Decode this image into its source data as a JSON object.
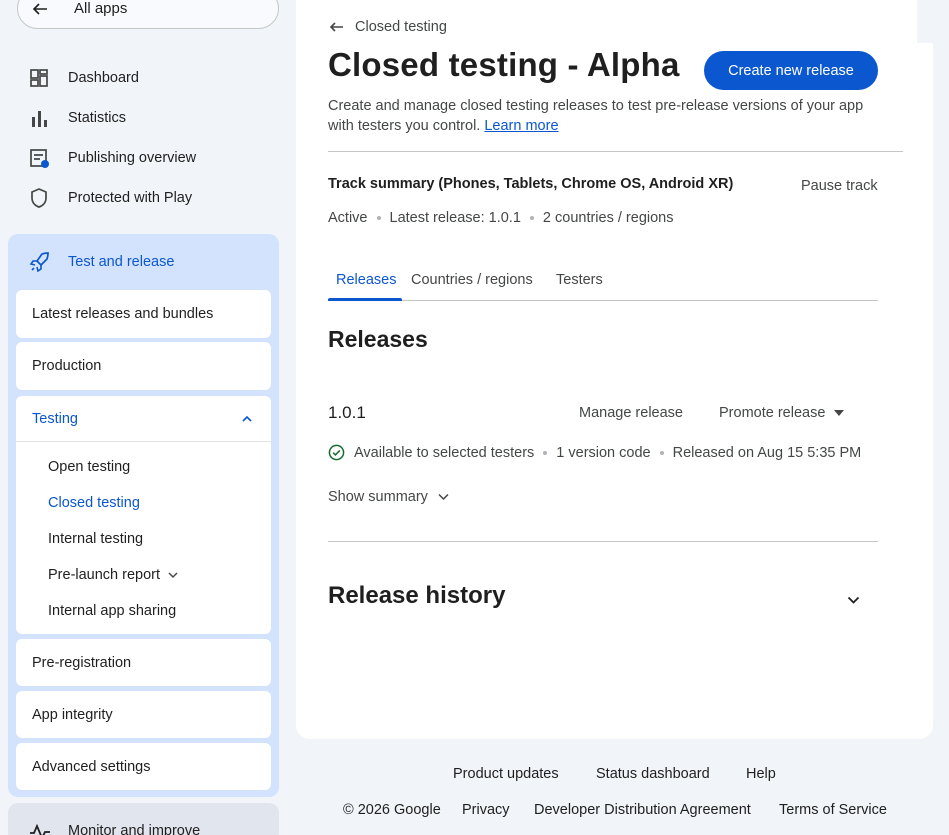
{
  "sidebar": {
    "all_apps": "All apps",
    "nav": [
      {
        "label": "Dashboard",
        "icon": "dashboard-icon"
      },
      {
        "label": "Statistics",
        "icon": "bar-chart-icon"
      },
      {
        "label": "Publishing overview",
        "icon": "publishing-overview-icon"
      },
      {
        "label": "Protected with Play",
        "icon": "shield-icon"
      }
    ],
    "test_and_release": {
      "label": "Test and release",
      "icon": "rocket-icon",
      "items": {
        "latest_releases": "Latest releases and bundles",
        "production": "Production",
        "testing": "Testing",
        "testing_sub": {
          "open": "Open testing",
          "closed": "Closed testing",
          "internal": "Internal testing",
          "pre_launch": "Pre-launch report",
          "internal_sharing": "Internal app sharing"
        },
        "pre_registration": "Pre-registration",
        "app_integrity": "App integrity",
        "advanced_settings": "Advanced settings"
      }
    },
    "monitor": {
      "label": "Monitor and improve",
      "icon": "monitor-icon"
    }
  },
  "main": {
    "breadcrumb": "Closed testing",
    "title": "Closed testing - Alpha",
    "create_button": "Create new release",
    "description": "Create and manage closed testing releases to test pre-release versions of your app with testers you control.",
    "learn_more": "Learn more",
    "track_summary": "Track summary (Phones, Tablets, Chrome OS, Android XR)",
    "pause_track": "Pause track",
    "track_meta": {
      "status": "Active",
      "latest_release": "Latest release: 1.0.1",
      "regions": "2 countries / regions"
    },
    "tabs": [
      "Releases",
      "Countries / regions",
      "Testers"
    ],
    "releases_heading": "Releases",
    "release": {
      "version": "1.0.1",
      "manage": "Manage release",
      "promote": "Promote release",
      "availability": "Available to selected testers",
      "version_codes": "1 version code",
      "released": "Released on Aug 15 5:35 PM",
      "show_summary": "Show summary"
    },
    "history_heading": "Release history"
  },
  "footer": {
    "product_updates": "Product updates",
    "status_dashboard": "Status dashboard",
    "help": "Help",
    "copyright": "© 2026 Google",
    "privacy": "Privacy",
    "dda": "Developer Distribution Agreement",
    "terms": "Terms of Service"
  },
  "colors": {
    "accent": "#0b57d0",
    "active_bg": "#d3e3fd",
    "page_bg": "#f1f4f9",
    "success": "#146c2e"
  }
}
